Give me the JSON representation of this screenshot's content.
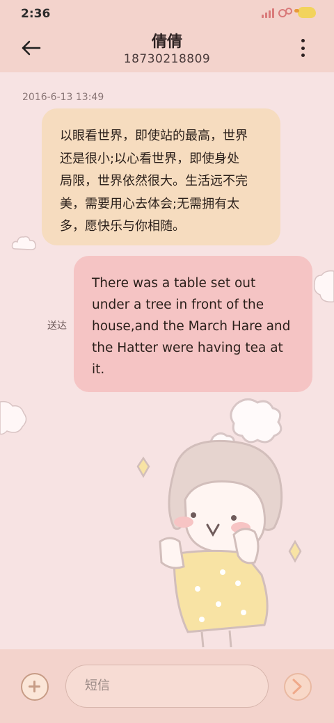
{
  "status_bar": {
    "time": "2:36"
  },
  "header": {
    "title": "倩倩",
    "subtitle": "18730218809"
  },
  "messages": [
    {
      "type": "received",
      "timestamp": "2016-6-13 13:49",
      "lines": [
        "以眼看世界，即使站的最高，世界",
        "还是很小;以心看世界，即使身处",
        "局限，世界依然很大。生活远不完",
        "美，需要用心去体会;无需拥有太",
        "多，愿快乐与你相随。"
      ]
    },
    {
      "type": "sent",
      "status": "送达",
      "lines": [
        "There was a table set out",
        "under a tree in front of the",
        "house,and the March Hare and",
        "the Hatter were having tea at",
        "it."
      ]
    }
  ],
  "input": {
    "placeholder": "短信"
  },
  "icons": {
    "back": "back-arrow-icon",
    "more": "more-vertical-icon",
    "add": "add-icon",
    "send": "send-icon"
  },
  "colors": {
    "header_bg": "#f3d3cc",
    "background": "#f7e3e3",
    "received_bubble": "#f6dcbf",
    "sent_bubble": "#f5c4c4"
  }
}
